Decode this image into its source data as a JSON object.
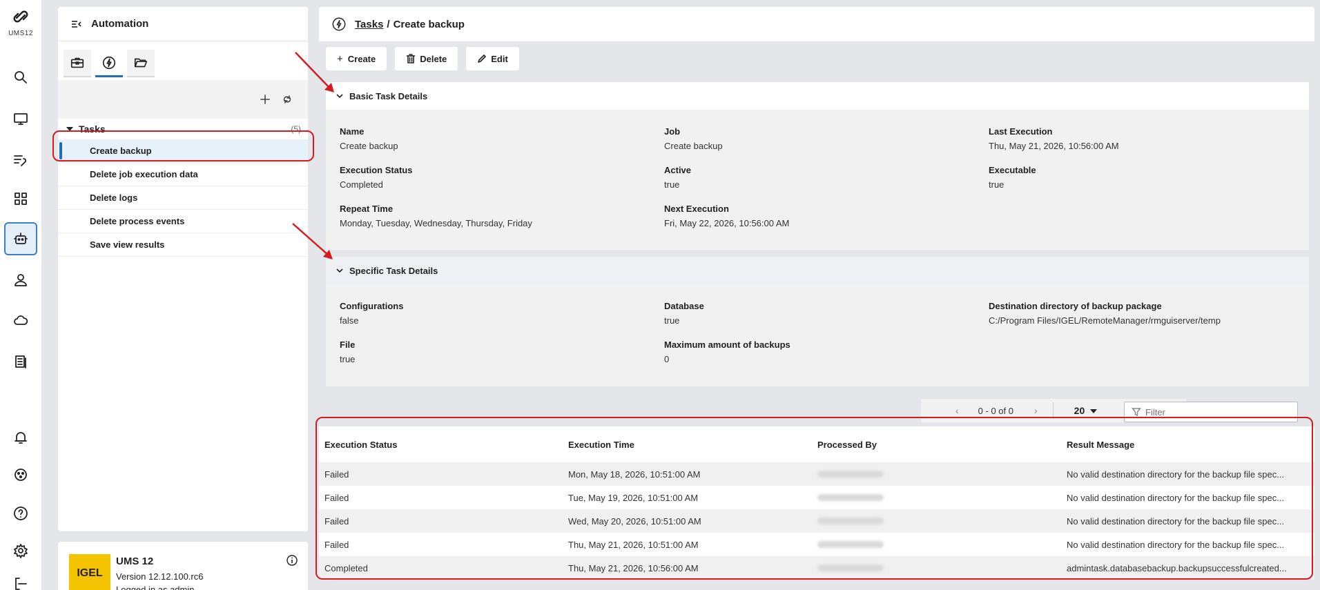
{
  "rail": {
    "logo_text": "UMS12",
    "items": [
      {
        "icon": "search-icon"
      },
      {
        "icon": "monitor-icon"
      },
      {
        "icon": "configuration-icon"
      },
      {
        "icon": "apps-icon"
      },
      {
        "icon": "robot-icon",
        "active": true
      },
      {
        "icon": "user-icon"
      },
      {
        "icon": "cloud-icon"
      },
      {
        "icon": "document-icon"
      },
      {
        "icon": "bell-icon"
      },
      {
        "icon": "network-icon"
      },
      {
        "icon": "help-icon"
      },
      {
        "icon": "settings-icon"
      },
      {
        "icon": "logout-icon"
      }
    ]
  },
  "panel": {
    "title": "Automation",
    "tabs": [
      "briefcase-icon",
      "bolt-icon",
      "folder-icon"
    ],
    "tree": {
      "group_label": "Tasks",
      "group_count": "(5)",
      "items": [
        "Create backup",
        "Delete job execution data",
        "Delete logs",
        "Delete process events",
        "Save view results"
      ]
    }
  },
  "footer": {
    "logo_text": "IGEL",
    "title": "UMS 12",
    "version": "Version 12.12.100.rc6",
    "user": "Logged in as admin"
  },
  "main": {
    "breadcrumb_link": "Tasks",
    "breadcrumb_sep": "/",
    "breadcrumb_current": "Create backup",
    "actions": {
      "create": "Create",
      "delete": "Delete",
      "edit": "Edit"
    },
    "basic_section": {
      "title": "Basic Task Details",
      "fields": {
        "name_label": "Name",
        "name_value": "Create backup",
        "job_label": "Job",
        "job_value": "Create backup",
        "last_exec_label": "Last Execution",
        "last_exec_value": "Thu, May 21, 2026, 10:56:00 AM",
        "exec_status_label": "Execution Status",
        "exec_status_value": "Completed",
        "active_label": "Active",
        "active_value": "true",
        "executable_label": "Executable",
        "executable_value": "true",
        "repeat_label": "Repeat Time",
        "repeat_value": "Monday, Tuesday, Wednesday, Thursday, Friday",
        "next_exec_label": "Next Execution",
        "next_exec_value": "Fri, May 22, 2026, 10:56:00 AM"
      }
    },
    "specific_section": {
      "title": "Specific Task Details",
      "fields": {
        "config_label": "Configurations",
        "config_value": "false",
        "db_label": "Database",
        "db_value": "true",
        "dest_label": "Destination directory of backup package",
        "dest_value": "C:/Program Files/IGEL/RemoteManager/rmguiserver/temp",
        "file_label": "File",
        "file_value": "true",
        "max_label": "Maximum amount of backups",
        "max_value": "0"
      }
    },
    "pager": {
      "prev": "‹",
      "range": "0 - 0 of 0",
      "next": "›",
      "page_size": "20"
    },
    "filter_placeholder": "Filter",
    "grid": {
      "columns": [
        "Execution Status",
        "Execution Time",
        "Processed By",
        "Result Message"
      ],
      "rows": [
        {
          "status": "Failed",
          "time": "Mon, May 18, 2026, 10:51:00 AM",
          "message": "No valid destination directory for the backup file spec..."
        },
        {
          "status": "Failed",
          "time": "Tue, May 19, 2026, 10:51:00 AM",
          "message": "No valid destination directory for the backup file spec..."
        },
        {
          "status": "Failed",
          "time": "Wed, May 20, 2026, 10:51:00 AM",
          "message": "No valid destination directory for the backup file spec..."
        },
        {
          "status": "Failed",
          "time": "Thu, May 21, 2026, 10:51:00 AM",
          "message": "No valid destination directory for the backup file spec..."
        },
        {
          "status": "Completed",
          "time": "Thu, May 21, 2026, 10:56:00 AM",
          "message": "admintask.databasebackup.backupsuccessfulcreated..."
        }
      ]
    }
  },
  "colors": {
    "accent": "#1f6fb5",
    "annotation": "#d71920",
    "logo_yellow": "#f5c400"
  }
}
